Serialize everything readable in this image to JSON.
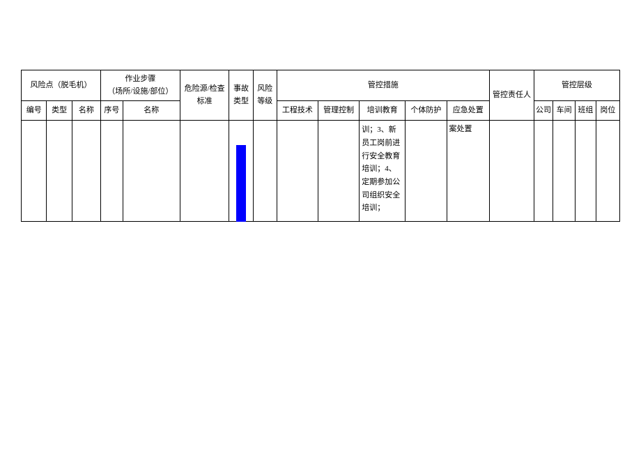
{
  "headers": {
    "risk_point": "风险点（脱毛机）",
    "work_steps": "作业步骤\n（场所/设施/部位）",
    "hazard_source": "危险源/检查标准",
    "accident_type": "事故类型",
    "risk_level": "风险等级",
    "control_measures": "管控措施",
    "control_responsible": "管控责任人",
    "control_hierarchy": "管控层级"
  },
  "sub_headers": {
    "serial_no": "编号",
    "type": "类型",
    "name": "名称",
    "step_no": "序号",
    "step_name": "名称",
    "eng_tech": "工程技术",
    "mgmt_control": "管理控制",
    "training_edu": "培训教育",
    "individual_protect": "个体防护",
    "emergency": "应急处置",
    "company": "公司",
    "workshop": "车间",
    "team": "班组",
    "position": "岗位"
  },
  "body": {
    "training_text": "训；3、新员工岗前进行安全教育培训；4、定期参加公司组织安全培训；",
    "emergency_text": "案处置"
  }
}
